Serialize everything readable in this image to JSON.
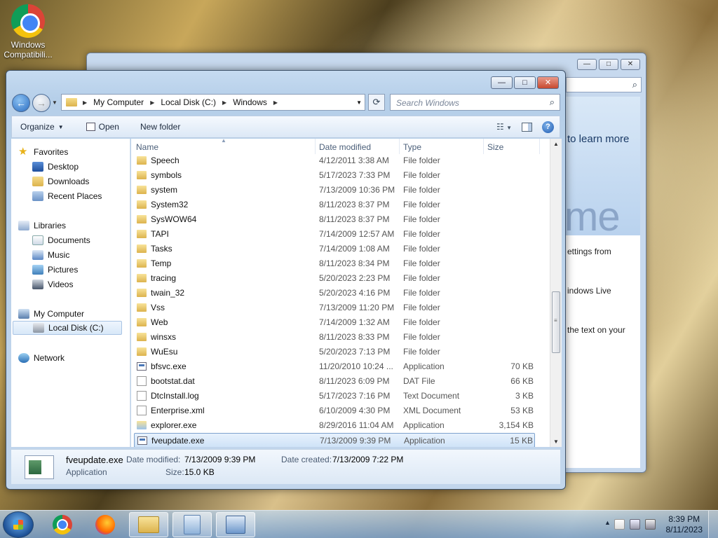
{
  "desktop": {
    "icon_label_line1": "Windows",
    "icon_label_line2": "Compatibili..."
  },
  "background_window": {
    "line_learn": "to learn more",
    "big_text": "me",
    "line1": "ettings from",
    "line2": "indows Live",
    "line3": "the text on your"
  },
  "address_bar": {
    "crumbs": [
      "My Computer",
      "Local Disk (C:)",
      "Windows"
    ],
    "search_placeholder": "Search Windows"
  },
  "toolbar": {
    "organize": "Organize",
    "open": "Open",
    "new_folder": "New folder"
  },
  "nav_pane": {
    "favorites": "Favorites",
    "desktop": "Desktop",
    "downloads": "Downloads",
    "recent_places": "Recent Places",
    "libraries": "Libraries",
    "documents": "Documents",
    "music": "Music",
    "pictures": "Pictures",
    "videos": "Videos",
    "my_computer": "My Computer",
    "local_disk": "Local Disk (C:)",
    "network": "Network"
  },
  "columns": {
    "name": "Name",
    "date_modified": "Date modified",
    "type": "Type",
    "size": "Size"
  },
  "files": [
    {
      "name": "Speech",
      "date": "4/12/2011 3:38 AM",
      "type": "File folder",
      "size": "",
      "icon": "folder"
    },
    {
      "name": "symbols",
      "date": "5/17/2023 7:33 PM",
      "type": "File folder",
      "size": "",
      "icon": "folder"
    },
    {
      "name": "system",
      "date": "7/13/2009 10:36 PM",
      "type": "File folder",
      "size": "",
      "icon": "folder"
    },
    {
      "name": "System32",
      "date": "8/11/2023 8:37 PM",
      "type": "File folder",
      "size": "",
      "icon": "folder"
    },
    {
      "name": "SysWOW64",
      "date": "8/11/2023 8:37 PM",
      "type": "File folder",
      "size": "",
      "icon": "folder"
    },
    {
      "name": "TAPI",
      "date": "7/14/2009 12:57 AM",
      "type": "File folder",
      "size": "",
      "icon": "folder"
    },
    {
      "name": "Tasks",
      "date": "7/14/2009 1:08 AM",
      "type": "File folder",
      "size": "",
      "icon": "folder"
    },
    {
      "name": "Temp",
      "date": "8/11/2023 8:34 PM",
      "type": "File folder",
      "size": "",
      "icon": "folder"
    },
    {
      "name": "tracing",
      "date": "5/20/2023 2:23 PM",
      "type": "File folder",
      "size": "",
      "icon": "folder"
    },
    {
      "name": "twain_32",
      "date": "5/20/2023 4:16 PM",
      "type": "File folder",
      "size": "",
      "icon": "folder"
    },
    {
      "name": "Vss",
      "date": "7/13/2009 11:20 PM",
      "type": "File folder",
      "size": "",
      "icon": "folder"
    },
    {
      "name": "Web",
      "date": "7/14/2009 1:32 AM",
      "type": "File folder",
      "size": "",
      "icon": "folder"
    },
    {
      "name": "winsxs",
      "date": "8/11/2023 8:33 PM",
      "type": "File folder",
      "size": "",
      "icon": "folder"
    },
    {
      "name": "WuEsu",
      "date": "5/20/2023 7:13 PM",
      "type": "File folder",
      "size": "",
      "icon": "folder"
    },
    {
      "name": "bfsvc.exe",
      "date": "11/20/2010 10:24 ...",
      "type": "Application",
      "size": "70 KB",
      "icon": "app"
    },
    {
      "name": "bootstat.dat",
      "date": "8/11/2023 6:09 PM",
      "type": "DAT File",
      "size": "66 KB",
      "icon": "doc"
    },
    {
      "name": "DtcInstall.log",
      "date": "5/17/2023 7:16 PM",
      "type": "Text Document",
      "size": "3 KB",
      "icon": "doc"
    },
    {
      "name": "Enterprise.xml",
      "date": "6/10/2009 4:30 PM",
      "type": "XML Document",
      "size": "53 KB",
      "icon": "xml"
    },
    {
      "name": "explorer.exe",
      "date": "8/29/2016 11:04 AM",
      "type": "Application",
      "size": "3,154 KB",
      "icon": "expl"
    },
    {
      "name": "fveupdate.exe",
      "date": "7/13/2009 9:39 PM",
      "type": "Application",
      "size": "15 KB",
      "icon": "app",
      "selected": true
    }
  ],
  "details_pane": {
    "file_name": "fveupdate.exe",
    "file_type": "Application",
    "date_modified_label": "Date modified:",
    "date_modified_value": "7/13/2009 9:39 PM",
    "date_created_label": "Date created:",
    "date_created_value": "7/13/2009 7:22 PM",
    "size_label": "Size:",
    "size_value": "15.0 KB"
  },
  "taskbar": {
    "time": "8:39 PM",
    "date": "8/11/2023"
  }
}
